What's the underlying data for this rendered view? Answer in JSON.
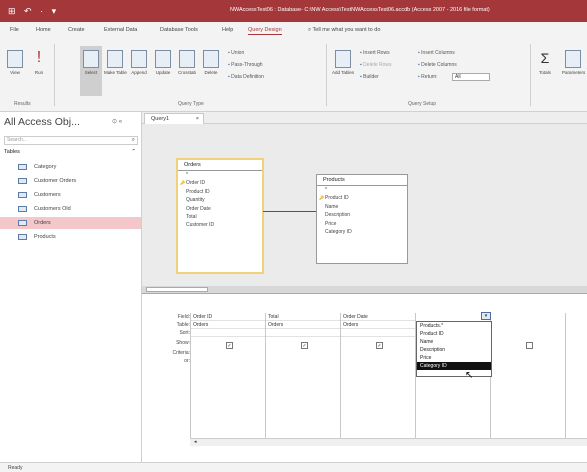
{
  "titlebar": {
    "quick_access": "⊞ ↶ · ▾",
    "title": "NWAccessTest06 : Database- C:\\NW Access\\TestNWAccessTest06.accdb (Access 2007 - 2016 file format)"
  },
  "menu": {
    "tabs": [
      "File",
      "Home",
      "Create",
      "External Data",
      "Database Tools",
      "Help",
      "Query Design"
    ],
    "active": "Query Design",
    "tell_me": "Tell me what you want to do"
  },
  "ribbon": {
    "results": {
      "view": "View",
      "run": "Run",
      "label": "Results"
    },
    "query_type": {
      "select": "Select",
      "make_table": "Make Table",
      "append": "Append",
      "update": "Update",
      "crosstab": "Crosstab",
      "delete": "Delete",
      "union": "Union",
      "pass_through": "Pass-Through",
      "data_def": "Data Definition",
      "label": "Query Type"
    },
    "setup": {
      "add_tables": "Add Tables",
      "insert_rows": "Insert Rows",
      "delete_rows": "Delete Rows",
      "builder": "Builder",
      "insert_columns": "Insert Columns",
      "delete_columns": "Delete Columns",
      "return": "Return:",
      "return_value": "All",
      "label": "Query Setup"
    },
    "show_hide": {
      "totals": "Totals",
      "parameters": "Parameters"
    }
  },
  "nav": {
    "title": "All Access Obj...",
    "controls": "⊙ «",
    "search_placeholder": "Search...",
    "group": "Tables",
    "items": [
      "Category",
      "Customer Orders",
      "Customers",
      "Customers Old",
      "Orders",
      "Products"
    ],
    "selected": "Orders"
  },
  "doc_tab": {
    "label": "Query1",
    "close": "×"
  },
  "tables": {
    "orders": {
      "name": "Orders",
      "fields": [
        "*",
        "Order ID",
        "Product ID",
        "Quantity",
        "Order Date",
        "Total",
        "Customer ID"
      ],
      "key": "Order ID"
    },
    "products": {
      "name": "Products",
      "fields": [
        "*",
        "Product ID",
        "Name",
        "Description",
        "Price",
        "Category ID"
      ],
      "key": "Product ID"
    }
  },
  "grid": {
    "row_labels": [
      "Field:",
      "Table:",
      "Sort:",
      "Show:",
      "Criteria:",
      "or:"
    ],
    "columns": [
      {
        "field": "Order ID",
        "table": "Orders",
        "show": true
      },
      {
        "field": "Total",
        "table": "Orders",
        "show": true
      },
      {
        "field": "Order Date",
        "table": "Orders",
        "show": true
      },
      {
        "field": "",
        "table": "",
        "show": false
      }
    ],
    "dropdown": {
      "options": [
        "Products.*",
        "Product ID",
        "Name",
        "Description",
        "Price",
        "Category ID"
      ],
      "highlighted": "Category ID"
    }
  },
  "status": "Ready",
  "colors": {
    "accent": "#a4373a",
    "selected_nav": "#f4c7cb"
  }
}
